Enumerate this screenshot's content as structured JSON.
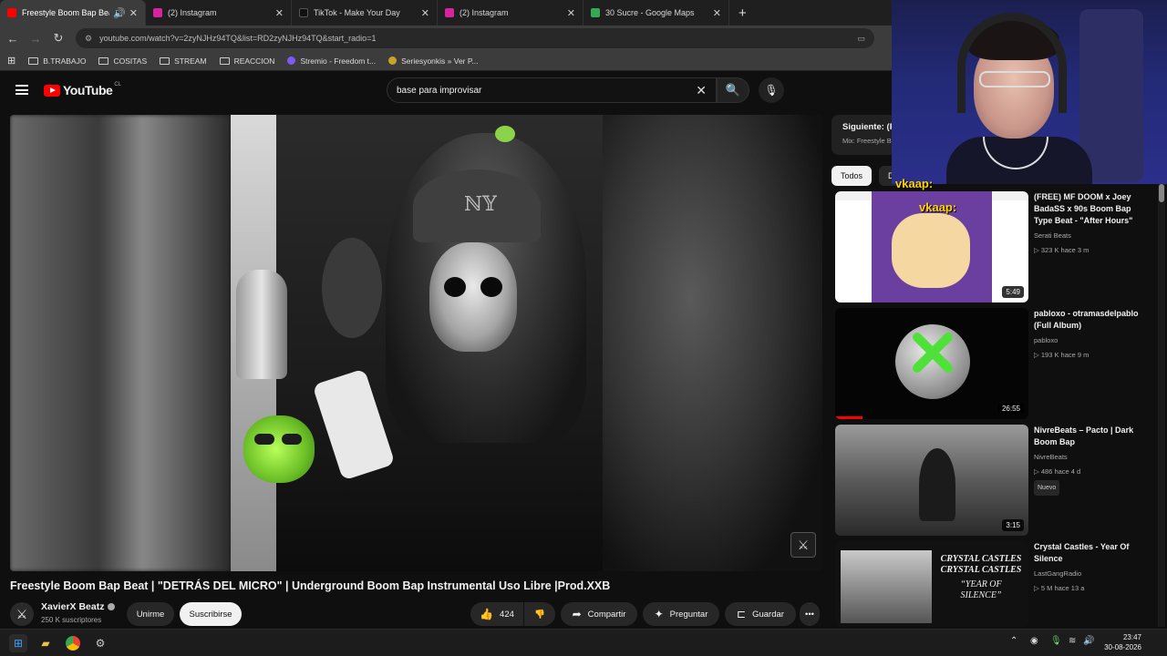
{
  "browser": {
    "tabs": [
      {
        "label": "Freestyle Boom Bap Beat | ",
        "active": true,
        "favicon_color": "#ff0000"
      },
      {
        "label": "(2) Instagram",
        "active": false,
        "favicon_color": "#d6249f"
      },
      {
        "label": "TikTok - Make Your Day",
        "active": false,
        "favicon_color": "#111111"
      },
      {
        "label": "(2) Instagram",
        "active": false,
        "favicon_color": "#d6249f"
      },
      {
        "label": "30 Sucre - Google Maps",
        "active": false,
        "favicon_color": "#34a853"
      }
    ],
    "new_tab_label": "+",
    "url": "youtube.com/watch?v=2zyNJHz94TQ&list=RD2zyNJHz94TQ&start_radio=1",
    "bookmarks": [
      {
        "label": "B.TRABAJO",
        "type": "folder"
      },
      {
        "label": "COSITAS",
        "type": "folder"
      },
      {
        "label": "STREAM",
        "type": "folder"
      },
      {
        "label": "REACCION",
        "type": "folder"
      },
      {
        "label": "Stremio - Freedom t...",
        "type": "site",
        "color": "#7b5bf2"
      },
      {
        "label": "Seriesyonkis » Ver P...",
        "type": "site",
        "color": "#c9a227"
      }
    ]
  },
  "youtube": {
    "logo_text": "YouTube",
    "region": "CL",
    "search_value": "base para improvisar",
    "video": {
      "title": "Freestyle Boom Bap Beat | \"DETRÁS DEL MICRO\" | Underground Boom Bap Instrumental Uso Libre |Prod.XXB",
      "channel": "XavierX Beatz",
      "subscribers": "250 K suscriptores",
      "join_label": "Unirme",
      "subscribe_label": "Suscribirse",
      "likes": "424",
      "share_label": "Compartir",
      "ask_label": "Preguntar",
      "save_label": "Guardar"
    },
    "sidebar": {
      "next_title": "Siguiente: (F",
      "next_sub": "Mix: Freestyle B",
      "chips": [
        "Todos",
        "De"
      ],
      "recommendations": [
        {
          "title": "(FREE) MF DOOM x Joey BadaSS x 90s Boom Bap Type Beat - \"After Hours\"",
          "channel": "Serati Beats",
          "meta": "▷ 323 K  hace 3 m",
          "duration": "5:49",
          "badge": ""
        },
        {
          "title": "pabloxo - otramasdelpablo (Full Album)",
          "channel": "pabloxo",
          "meta": "▷ 193 K  hace 9 m",
          "duration": "26:55",
          "badge": "",
          "progress": 0.14
        },
        {
          "title": "NivreBeats – Pacto | Dark Boom Bap",
          "channel": "NivreBeats",
          "meta": "▷ 486  hace 4 d",
          "duration": "3:15",
          "badge": "Nuevo"
        },
        {
          "title": "Crystal Castles - Year Of Silence",
          "channel": "LastGangRadio",
          "meta": "▷ 5 M  hace 13 a",
          "duration": "",
          "badge": ""
        }
      ]
    }
  },
  "overlay": {
    "chat_user_1": "vkaap:",
    "chat_user_2": "vkaap:"
  },
  "taskbar": {
    "time": "23:47",
    "date": "30-08-2026"
  }
}
